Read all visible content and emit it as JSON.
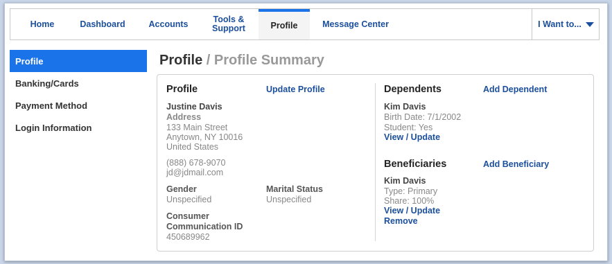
{
  "nav": {
    "home": "Home",
    "dashboard": "Dashboard",
    "accounts": "Accounts",
    "tools_line1": "Tools &",
    "tools_line2": "Support",
    "profile": "Profile",
    "message_center": "Message Center",
    "i_want_to": "I Want to..."
  },
  "sidebar": {
    "items": [
      {
        "label": "Profile",
        "active": true
      },
      {
        "label": "Banking/Cards",
        "active": false
      },
      {
        "label": "Payment Method",
        "active": false
      },
      {
        "label": "Login Information",
        "active": false
      }
    ]
  },
  "page": {
    "title": "Profile",
    "subtitle": " / Profile Summary"
  },
  "profile": {
    "heading": "Profile",
    "update_link": "Update Profile",
    "name": "Justine Davis",
    "address_label": "Address",
    "street": "133 Main Street",
    "city_state_zip": "Anytown, NY 10016",
    "country": "United States",
    "phone": "(888) 678-9070",
    "email": "jd@jdmail.com",
    "gender_label": "Gender",
    "gender_value": "Unspecified",
    "marital_label": "Marital Status",
    "marital_value": "Unspecified",
    "ccid_label_line1": "Consumer",
    "ccid_label_line2": "Communication ID",
    "ccid_value": "450689962"
  },
  "dependents": {
    "heading": "Dependents",
    "add_link": "Add Dependent",
    "name": "Kim Davis",
    "birth_date": "Birth Date: 7/1/2002",
    "student": "Student: Yes",
    "view_update": "View / Update"
  },
  "beneficiaries": {
    "heading": "Beneficiaries",
    "add_link": "Add Beneficiary",
    "name": "Kim Davis",
    "type": "Type: Primary",
    "share": "Share: 100%",
    "view_update": "View / Update",
    "remove": "Remove"
  },
  "colors": {
    "accent": "#1a73e8",
    "link": "#1b4f9c",
    "background": "#c9d6ea"
  }
}
